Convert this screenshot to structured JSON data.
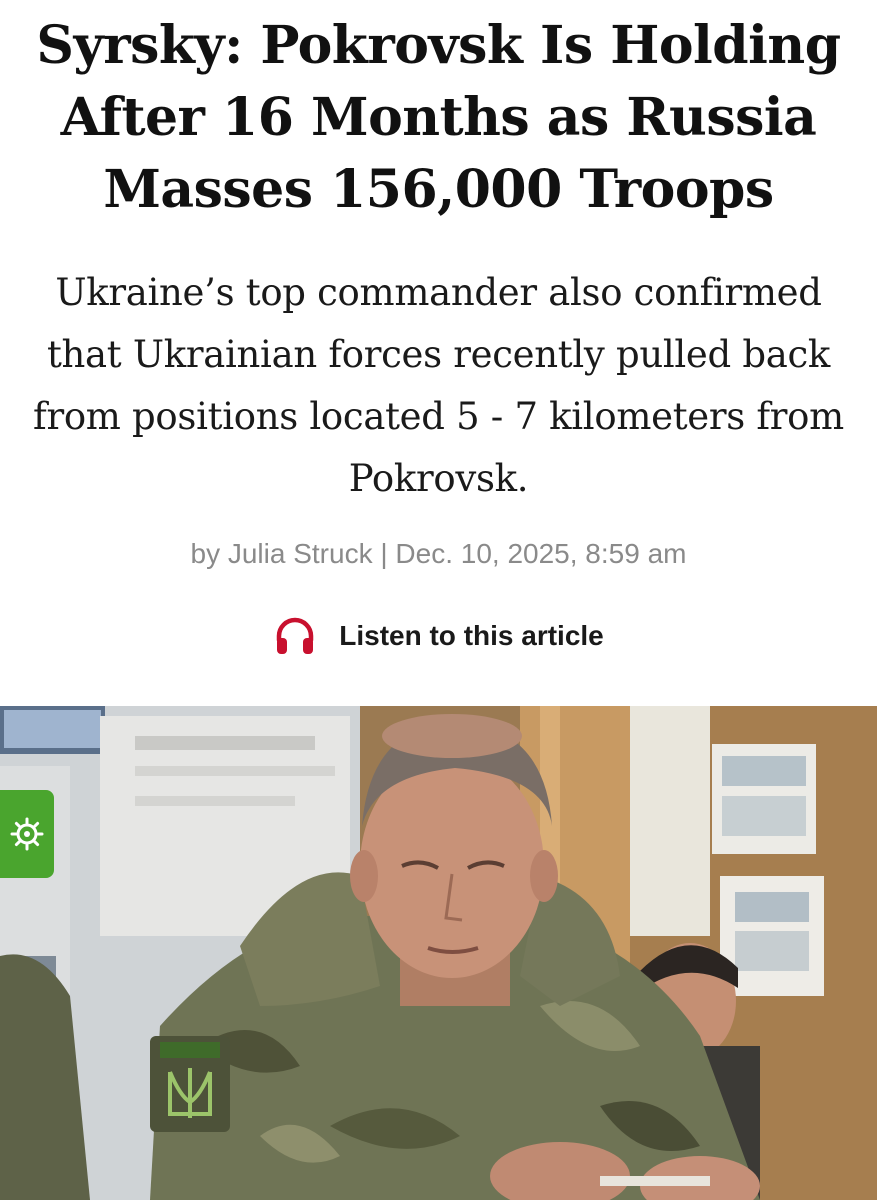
{
  "article": {
    "headline": "Syrsky: Pokrovsk Is Holding After 16 Months as Russia Masses 156,000 Troops",
    "subheadline": "Ukraine’s top commander also confirmed that Ukrainian forces recently pulled back from positions located 5 - 7 kilometers from Pokrovsk.",
    "byline": "by Julia Struck | Dec. 10, 2025, 8:59 am"
  },
  "listen": {
    "label": "Listen to this article",
    "icon": "headphones-icon",
    "icon_color": "#c8102e"
  },
  "settings_tab": {
    "icon": "gear-icon",
    "color": "#4aa52e"
  },
  "photo": {
    "subject": "military-commander-photo"
  }
}
